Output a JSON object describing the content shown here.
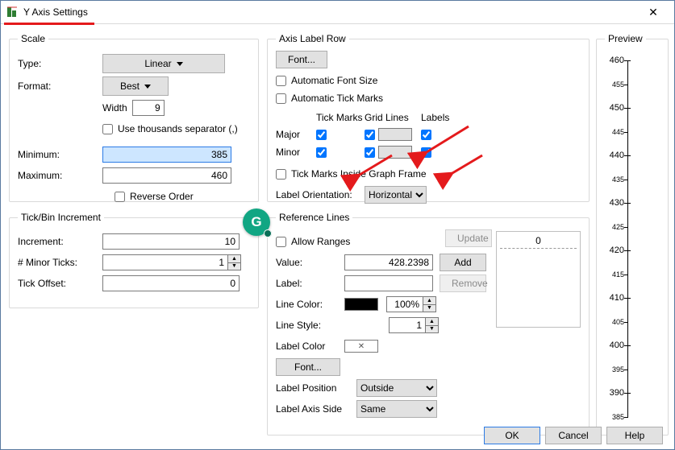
{
  "window": {
    "title": "Y Axis Settings"
  },
  "scale": {
    "legend": "Scale",
    "type_label": "Type:",
    "type_value": "Linear",
    "format_label": "Format:",
    "format_value": "Best",
    "width_label": "Width",
    "width_value": "9",
    "thousands_label": "Use thousands separator (,)",
    "min_label": "Minimum:",
    "min_value": "385",
    "max_label": "Maximum:",
    "max_value": "460",
    "reverse_label": "Reverse Order"
  },
  "tickbin": {
    "legend": "Tick/Bin Increment",
    "increment_label": "Increment:",
    "increment_value": "10",
    "minor_label": "# Minor Ticks:",
    "minor_value": "1",
    "offset_label": "Tick Offset:",
    "offset_value": "0"
  },
  "axis": {
    "legend": "Axis Label Row",
    "font_btn": "Font...",
    "auto_font_label": "Automatic Font Size",
    "auto_tick_label": "Automatic Tick Marks",
    "col_tick": "Tick Marks",
    "col_grid": "Grid Lines",
    "col_labels": "Labels",
    "row_major": "Major",
    "row_minor": "Minor",
    "inside_label": "Tick Marks Inside Graph Frame",
    "orient_label": "Label Orientation:",
    "orient_value": "Horizontal"
  },
  "ref": {
    "legend": "Reference Lines",
    "allow_label": "Allow Ranges",
    "update_btn": "Update",
    "add_btn": "Add",
    "remove_btn": "Remove",
    "value_label": "Value:",
    "value_value": "428.2398",
    "label_label": "Label:",
    "label_value": "",
    "linecolor_label": "Line Color:",
    "opacity_value": "100%",
    "linestyle_label": "Line Style:",
    "linestyle_value": "1",
    "labcolor_label": "Label Color",
    "font_btn": "Font...",
    "labpos_label": "Label Position",
    "labpos_value": "Outside",
    "labside_label": "Label Axis Side",
    "labside_value": "Same",
    "listbox_zero": "0"
  },
  "preview": {
    "legend": "Preview",
    "ticks": [
      {
        "label": "460",
        "pos": 0.0,
        "major": true
      },
      {
        "label": "455",
        "pos": 0.0667,
        "major": false
      },
      {
        "label": "450",
        "pos": 0.1333,
        "major": true
      },
      {
        "label": "445",
        "pos": 0.2,
        "major": false
      },
      {
        "label": "440",
        "pos": 0.2667,
        "major": true
      },
      {
        "label": "435",
        "pos": 0.3333,
        "major": false
      },
      {
        "label": "430",
        "pos": 0.4,
        "major": true
      },
      {
        "label": "425",
        "pos": 0.4667,
        "major": false
      },
      {
        "label": "420",
        "pos": 0.5333,
        "major": true
      },
      {
        "label": "415",
        "pos": 0.6,
        "major": false
      },
      {
        "label": "410",
        "pos": 0.6667,
        "major": true
      },
      {
        "label": "405",
        "pos": 0.7333,
        "major": false
      },
      {
        "label": "400",
        "pos": 0.8,
        "major": true
      },
      {
        "label": "395",
        "pos": 0.8667,
        "major": false
      },
      {
        "label": "390",
        "pos": 0.9333,
        "major": true
      },
      {
        "label": "385",
        "pos": 1.0,
        "major": false
      }
    ]
  },
  "buttons": {
    "ok": "OK",
    "cancel": "Cancel",
    "help": "Help"
  },
  "chart_data": {
    "type": "axis-preview",
    "axis": "Y",
    "ylim": [
      385,
      460
    ],
    "major_interval": 10,
    "minor_ticks_per_major": 1,
    "major_tick_values": [
      390,
      400,
      410,
      420,
      430,
      440,
      450,
      460
    ],
    "minor_tick_values": [
      385,
      395,
      405,
      415,
      425,
      435,
      445,
      455
    ],
    "labels_on_major": true,
    "labels_on_minor": true
  }
}
